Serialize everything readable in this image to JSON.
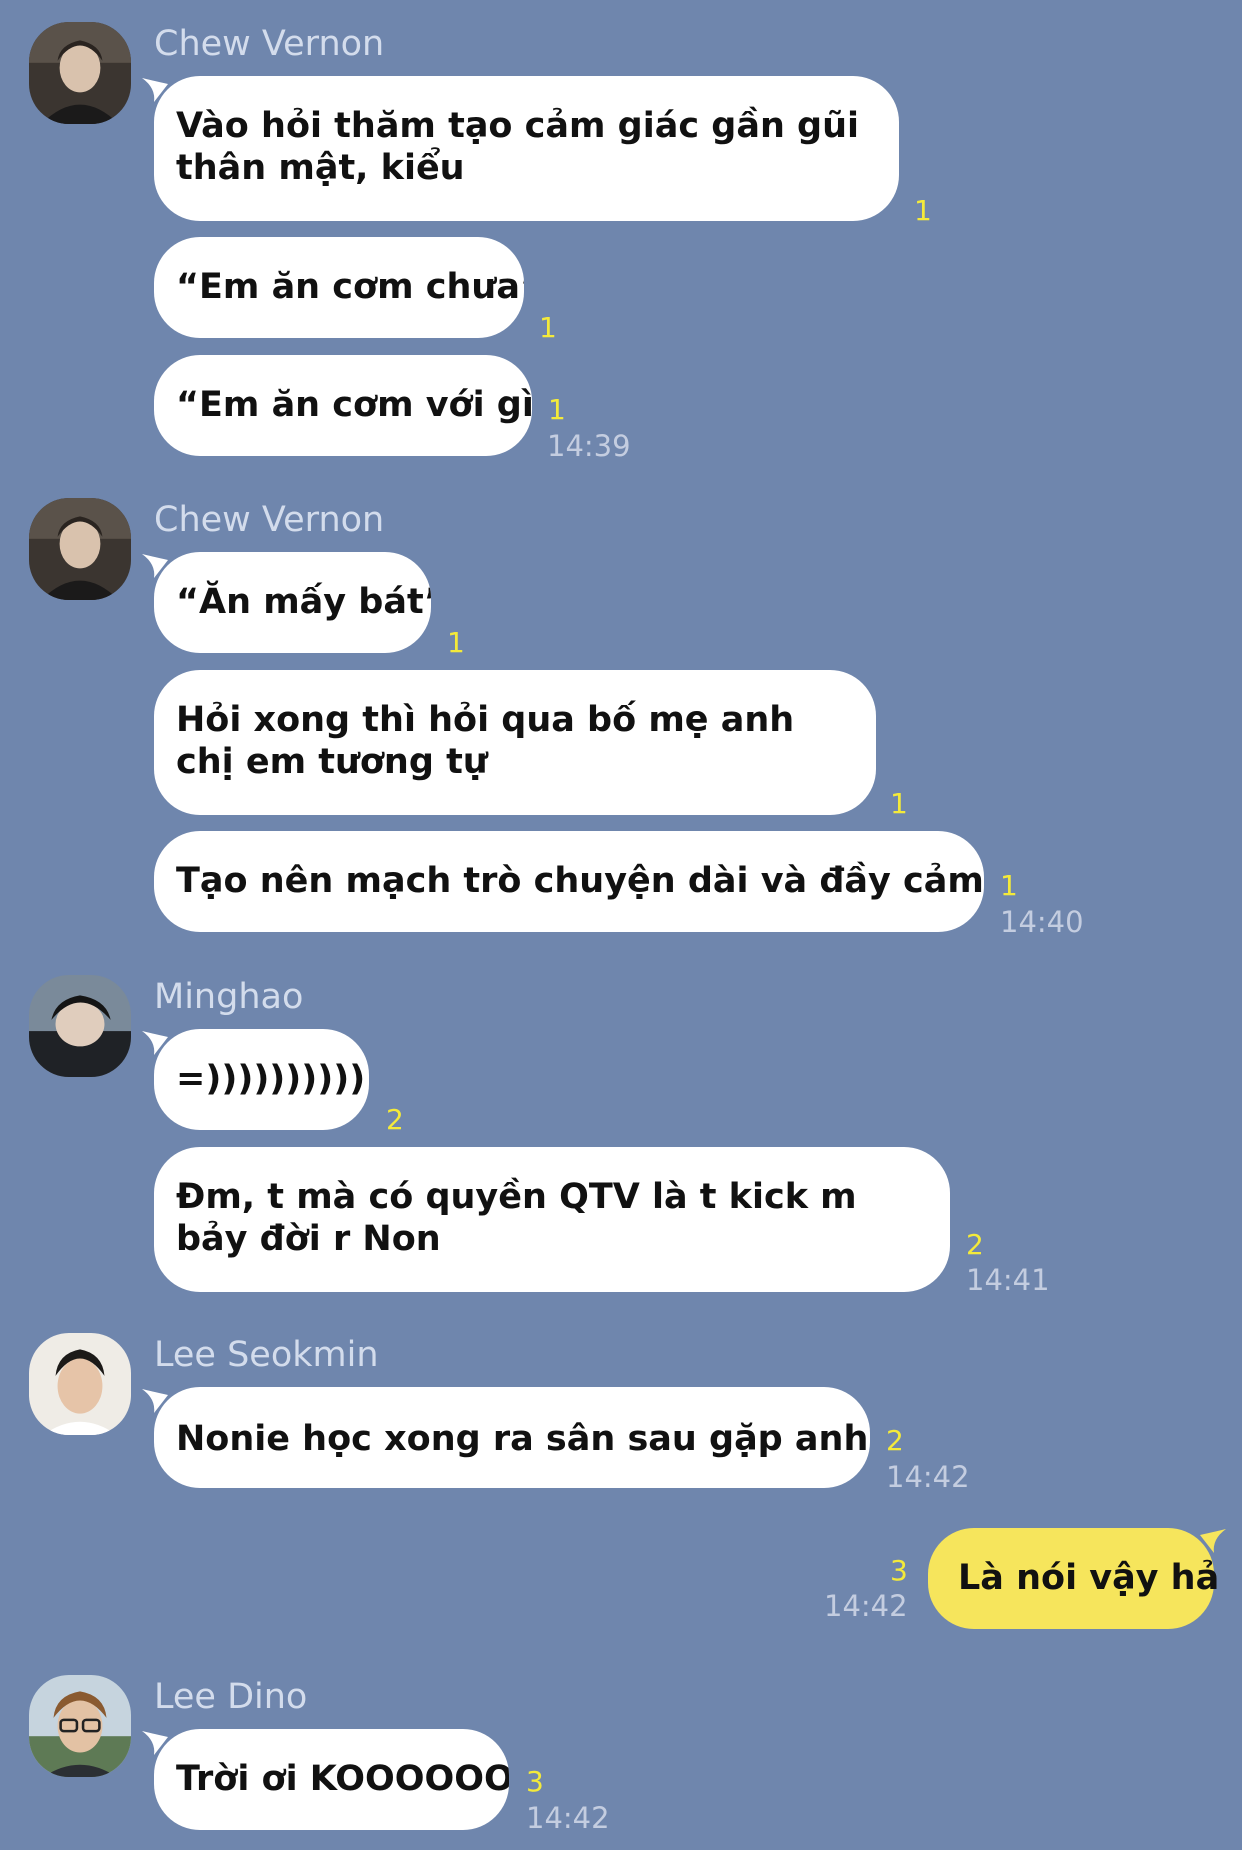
{
  "colors": {
    "background": "#6f86ad",
    "bubble_incoming": "#ffffff",
    "bubble_outgoing": "#f6e55c",
    "read_count": "#f4ea3a",
    "timestamp": "#c4cde0",
    "sender_name": "#d3dcec"
  },
  "groups": [
    {
      "sender": "Chew Vernon",
      "avatar_icon": "user-avatar-icon",
      "messages": [
        {
          "text": "Vào hỏi thăm tạo cảm giác gần gũi thân mật, kiểu",
          "unread": "1"
        },
        {
          "text": "“Em ăn cơm chưa”",
          "unread": "1"
        },
        {
          "text": "“Em ăn cơm với gì”",
          "unread": "1",
          "time": "14:39"
        }
      ]
    },
    {
      "sender": "Chew Vernon",
      "avatar_icon": "user-avatar-icon",
      "messages": [
        {
          "text": "“Ăn mấy bát”",
          "unread": "1"
        },
        {
          "text": "Hỏi xong thì hỏi qua bố mẹ anh chị em tương tự",
          "unread": "1"
        },
        {
          "text": "Tạo nên mạch trò chuyện dài và đầy cảm xúc",
          "unread": "1",
          "time": "14:40"
        }
      ]
    },
    {
      "sender": "Minghao",
      "avatar_icon": "user-avatar-icon",
      "messages": [
        {
          "text": "=))))))))))",
          "unread": "2"
        },
        {
          "text": "Đm, t mà có quyền QTV là t kick m bảy đời r Non",
          "unread": "2",
          "time": "14:41"
        }
      ]
    },
    {
      "sender": "Lee Seokmin",
      "avatar_icon": "user-avatar-icon",
      "messages": [
        {
          "text": "Nonie học xong ra sân sau gặp anh",
          "emoji": "sunglasses-emoji-icon",
          "unread": "2",
          "time": "14:42"
        }
      ]
    },
    {
      "sender": "Lee Dino",
      "avatar_icon": "user-avatar-icon",
      "messages": [
        {
          "text": "Trời ơi KOOOOOO",
          "unread": "3",
          "time": "14:42"
        }
      ]
    }
  ],
  "outgoing": {
    "text": "Là nói vậy hả",
    "unread": "3",
    "time": "14:42"
  }
}
